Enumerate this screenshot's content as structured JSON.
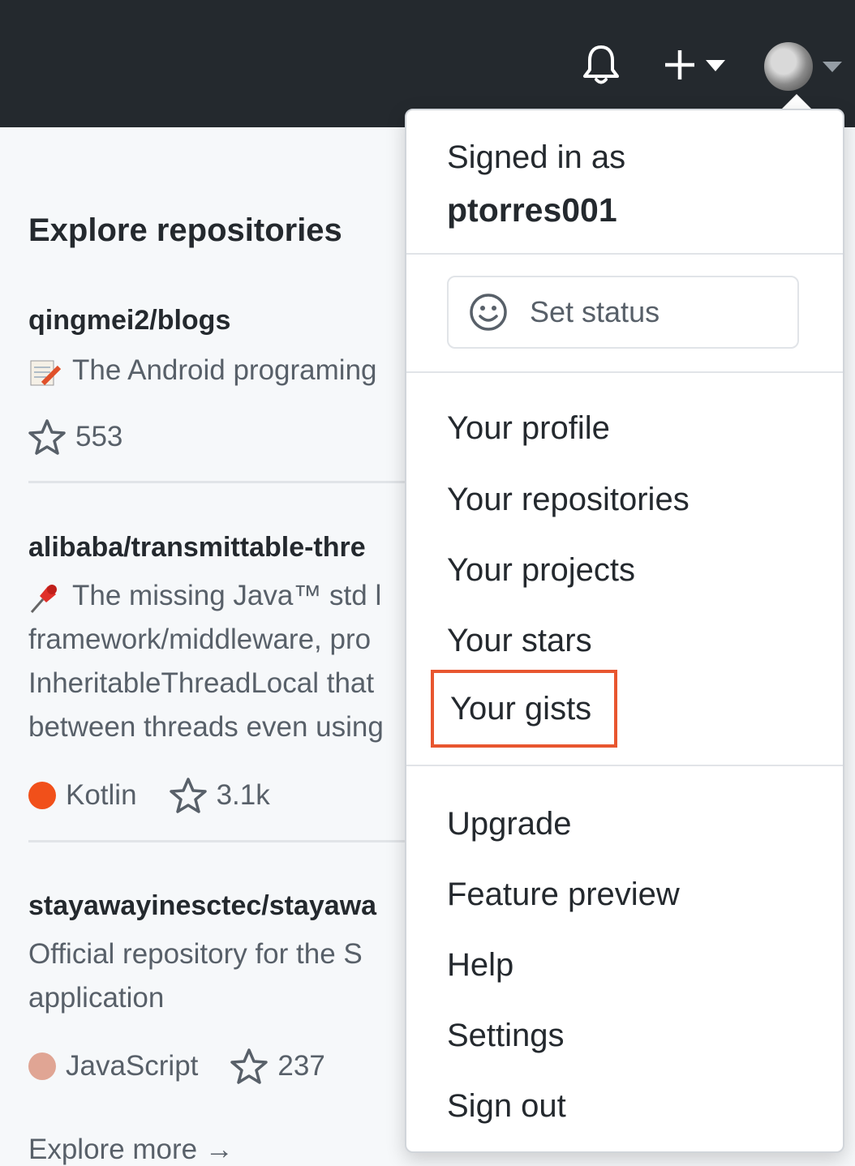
{
  "header": {
    "notifications_icon": "bell-icon",
    "create_icon": "plus-icon",
    "avatar_caret_icon": "caret-down-icon"
  },
  "explore": {
    "title": "Explore repositories",
    "repos": [
      {
        "name": "qingmei2/blogs",
        "emoji": "memo-emoji",
        "description_lines": [
          "The Android programing"
        ],
        "language": "",
        "stars": "553"
      },
      {
        "name": "alibaba/transmittable-thre",
        "emoji": "pushpin-emoji",
        "description_lines": [
          "The missing Java™ std l",
          "framework/middleware, pro",
          "InheritableThreadLocal that",
          "between threads even using"
        ],
        "language": "Kotlin",
        "language_color": "#f1501a",
        "stars": "3.1k"
      },
      {
        "name": "stayawayinesctec/stayawa",
        "description_lines": [
          "Official repository for the S",
          "application"
        ],
        "language": "JavaScript",
        "language_color": "#e0a594",
        "stars": "237"
      }
    ],
    "explore_more": "Explore more →"
  },
  "dropdown": {
    "signed_in_label": "Signed in as",
    "username": "ptorres001",
    "set_status": "Set status",
    "items_group1": [
      "Your profile",
      "Your repositories",
      "Your projects",
      "Your stars",
      "Your gists"
    ],
    "items_group2": [
      "Upgrade",
      "Feature preview",
      "Help",
      "Settings",
      "Sign out"
    ],
    "highlight_color": "#e8562f"
  }
}
